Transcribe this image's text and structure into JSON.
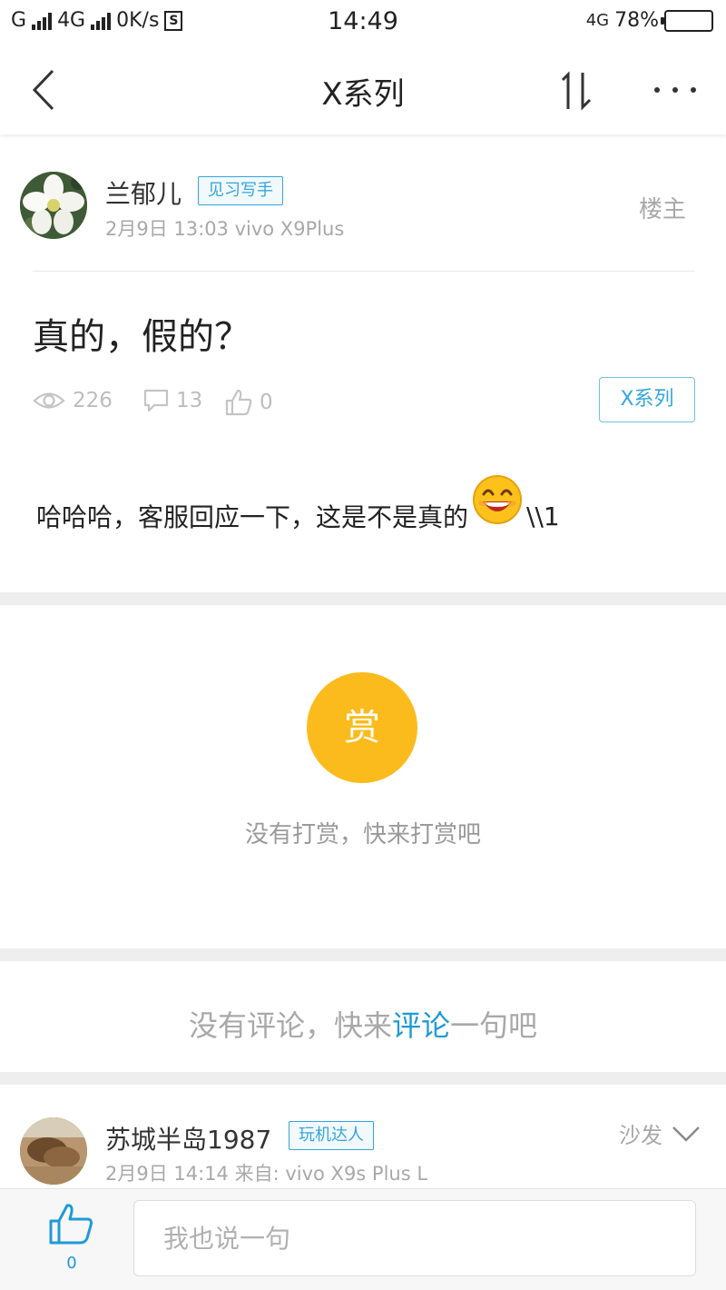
{
  "status_bar": {
    "carrier1": "G",
    "carrier2": "4G",
    "speed": "0K/s",
    "s_icon": "S",
    "time": "14:49",
    "network": "4G",
    "battery": "78%",
    "battery_level": 0.78
  },
  "nav": {
    "title": "X系列",
    "back_icon": "chevron-left-icon",
    "sort_icon": "sort-icon",
    "more_icon": "more-dots-icon"
  },
  "post": {
    "author": "兰郁儿",
    "author_badge": "见习写手",
    "meta": "2月9日 13:03 vivo X9Plus",
    "floor_label": "楼主",
    "title": "真的，假的？",
    "views": "226",
    "comments": "13",
    "likes": "0",
    "tag": "X系列",
    "body_before": "哈哈哈，客服回应一下，这是不是真的",
    "body_after": "\\\\1",
    "emoji": "grinning-emoji"
  },
  "reward": {
    "icon_label": "赏",
    "text": "没有打赏，快来打赏吧"
  },
  "comment_prompt": {
    "before": "没有评论，快来",
    "link": "评论",
    "after": "一句吧"
  },
  "reply": {
    "author": "苏城半岛1987",
    "author_badge": "玩机达人",
    "meta": "2月9日 14:14 来自: vivo X9s Plus L",
    "floor_label": "沙发"
  },
  "bottom_bar": {
    "like_count": "0",
    "input_placeholder": "我也说一句"
  },
  "colors": {
    "accent": "#1f9ad6",
    "reward": "#fbbb1c",
    "muted": "#a8a8a8"
  }
}
